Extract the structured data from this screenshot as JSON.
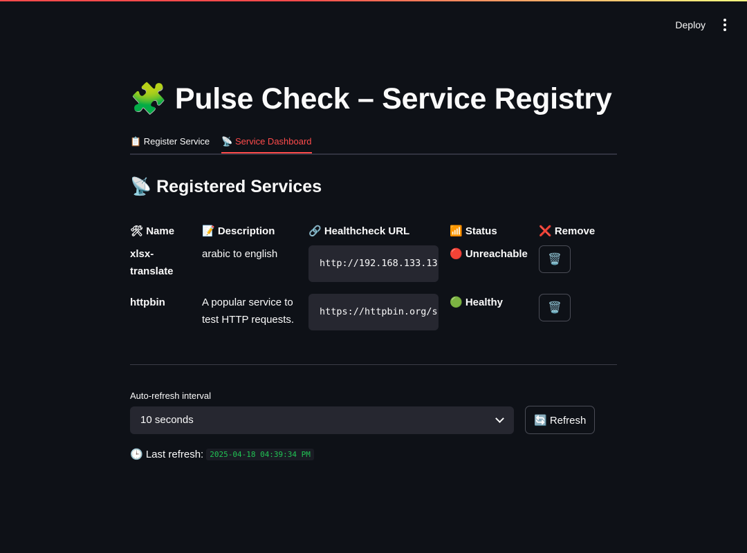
{
  "toolbar": {
    "deploy_label": "Deploy",
    "menu_icon": "kebab-menu-icon"
  },
  "page": {
    "title": "🧩 Pulse Check – Service Registry"
  },
  "tabs": [
    {
      "label": "📋 Register Service",
      "active": false
    },
    {
      "label": "📡 Service Dashboard",
      "active": true
    }
  ],
  "dashboard": {
    "section_title": "📡 Registered Services",
    "columns": {
      "name": "🛠 Name",
      "description": "📝 Description",
      "url": "🔗 Healthcheck URL",
      "status": "📶 Status",
      "remove": "❌ Remove"
    },
    "services": [
      {
        "name": "xlsx-translate",
        "description": "arabic to english",
        "url": "http://192.168.133.13",
        "status": "🔴 Unreachable",
        "remove_icon": "🗑️"
      },
      {
        "name": "httpbin",
        "description": "A popular service to test HTTP requests.",
        "url": "https://httpbin.org/s",
        "status": "🟢 Healthy",
        "remove_icon": "🗑️"
      }
    ]
  },
  "refresh": {
    "interval_label": "Auto-refresh interval",
    "interval_value": "10 seconds",
    "button_label": "🔄 Refresh",
    "last_refresh_label": "🕒 Last refresh:",
    "last_refresh_value": "2025-04-18 04:39:34 PM"
  },
  "colors": {
    "background": "#0e1117",
    "accent": "#ff4b4b",
    "input_bg": "#262730",
    "code_green": "#21c354"
  }
}
